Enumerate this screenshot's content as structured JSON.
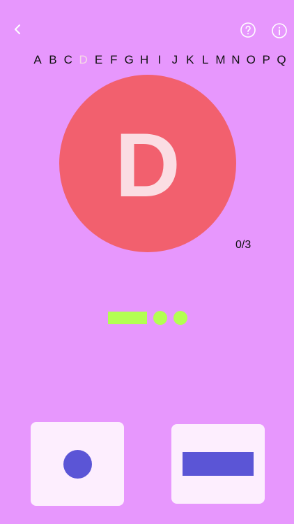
{
  "alphabet": [
    "A",
    "B",
    "C",
    "D",
    "E",
    "F",
    "G",
    "H",
    "I",
    "J",
    "K",
    "L",
    "M",
    "N",
    "O",
    "P",
    "Q"
  ],
  "current_letter": "D",
  "progress": "0/3",
  "morse_pattern": [
    "dash",
    "dot",
    "dot"
  ],
  "icons": {
    "back": "chevron-left-icon",
    "help": "help-circle-icon",
    "info": "info-circle-icon"
  },
  "colors": {
    "background": "#E797FD",
    "circle": "#F2606E",
    "circle_letter": "#FBDDE3",
    "morse": "#B3FF52",
    "key_bg": "#FDEEFE",
    "key_shape": "#5B55D6",
    "active_letter": "#F5D9E6"
  }
}
